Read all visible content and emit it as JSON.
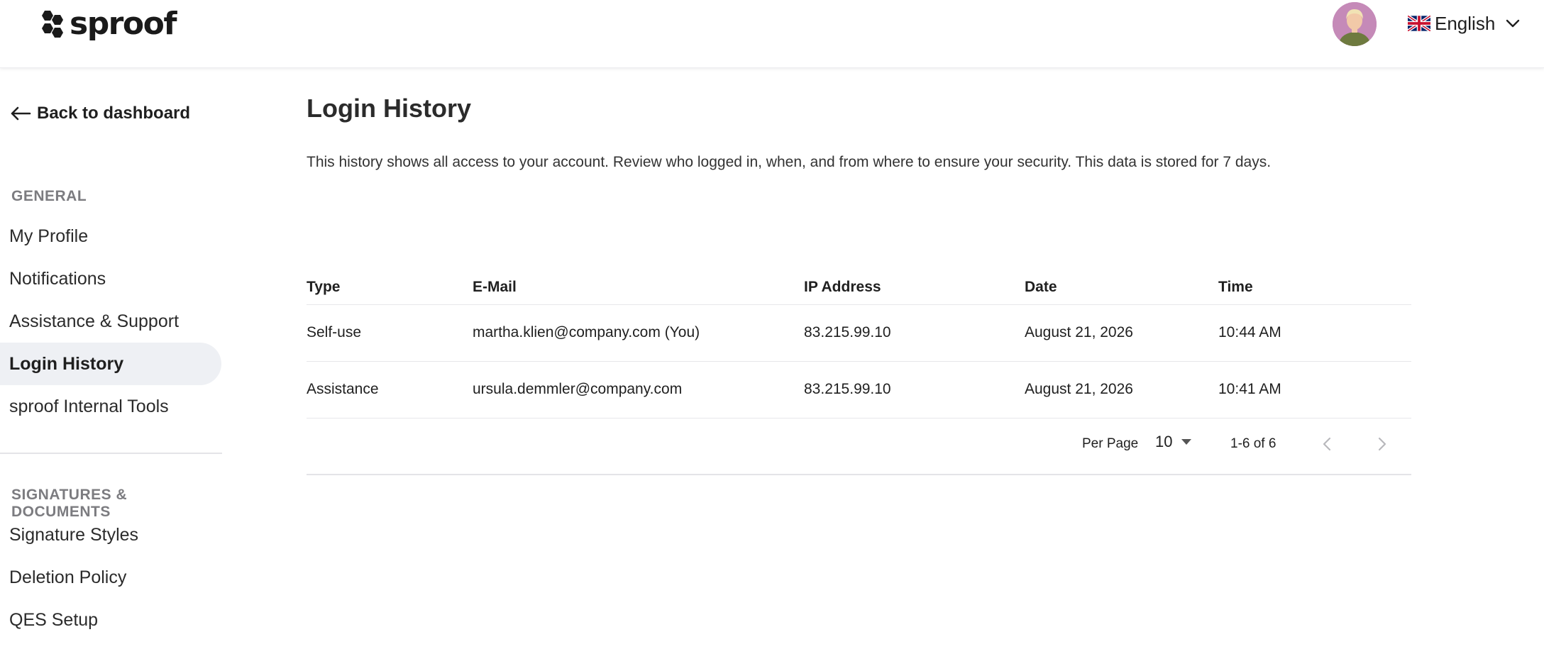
{
  "brand": {
    "name": "sproof"
  },
  "header": {
    "language_label": "English"
  },
  "sidebar": {
    "back_label": "Back to dashboard",
    "sections": [
      {
        "heading": "GENERAL",
        "items": [
          {
            "label": "My Profile",
            "active": false
          },
          {
            "label": "Notifications",
            "active": false
          },
          {
            "label": "Assistance & Support",
            "active": false
          },
          {
            "label": "Login History",
            "active": true
          },
          {
            "label": "sproof Internal Tools",
            "active": false
          }
        ]
      },
      {
        "heading": "SIGNATURES & DOCUMENTS",
        "items": [
          {
            "label": "Signature Styles",
            "active": false
          },
          {
            "label": "Deletion Policy",
            "active": false
          },
          {
            "label": "QES Setup",
            "active": false
          }
        ]
      }
    ]
  },
  "main": {
    "title": "Login History",
    "description": "This history shows all access to your account. Review who logged in, when, and from where to ensure your security. This data is stored for 7 days.",
    "table": {
      "columns": [
        "Type",
        "E-Mail",
        "IP Address",
        "Date",
        "Time"
      ],
      "rows": [
        [
          "Self-use",
          "martha.klien@company.com (You)",
          "83.215.99.10",
          "August 21, 2026",
          "10:44 AM"
        ],
        [
          "Assistance",
          "ursula.demmler@company.com",
          "83.215.99.10",
          "August 21, 2026",
          "10:41 AM"
        ]
      ]
    },
    "pagination": {
      "per_page_label": "Per Page",
      "per_page_value": "10",
      "range_label": "1-6 of 6"
    }
  },
  "colors": {
    "active_nav_bg": "#eef0f4",
    "section_heading": "#7c7c80",
    "divider": "#e7e7ea",
    "avatar_bg": "#c58ab8"
  },
  "icons": {
    "back": "arrow-left-icon",
    "language": "uk-flag-icon",
    "language_toggle": "chevron-down-icon",
    "per_page_toggle": "caret-down-icon",
    "prev_page": "chevron-left-icon",
    "next_page": "chevron-right-icon"
  }
}
